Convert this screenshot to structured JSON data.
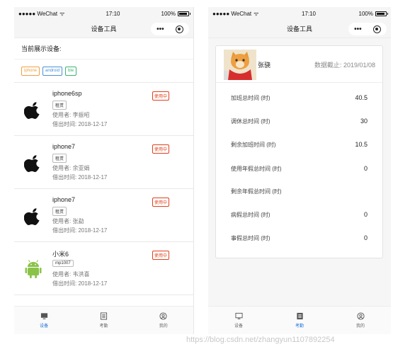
{
  "status_bar": {
    "carrier": "●●●●● WeChat",
    "wifi": "ᯤ",
    "time": "17:10",
    "battery": "100%"
  },
  "left_page": {
    "title": "设备工具",
    "section_title": "当前展示设备:",
    "filters": [
      {
        "label": "iphone",
        "color": "#f0a040"
      },
      {
        "label": "android",
        "color": "#4a90d9"
      },
      {
        "label": "ble",
        "color": "#3cb371"
      }
    ],
    "devices": [
      {
        "name": "iphone6sp",
        "tag": "租赁",
        "user": "使用者: 李振昭",
        "date": "借出时间: 2018-12-17",
        "status": "使用中",
        "logo": "apple-icon"
      },
      {
        "name": "iphone7",
        "tag": "租赁",
        "user": "使用者: 余亚娟",
        "date": "借出时间: 2018-12-17",
        "status": "使用中",
        "logo": "apple-icon"
      },
      {
        "name": "iphone7",
        "tag": "租赁",
        "user": "使用者: 张勐",
        "date": "借出时间: 2018-12-17",
        "status": "使用中",
        "logo": "apple-icon"
      },
      {
        "name": "小米6",
        "tag": "mp1007",
        "user": "使用者: 韦洪喜",
        "date": "借出时间: 2018-12-17",
        "status": "使用中",
        "logo": "android-icon"
      }
    ],
    "tabs": [
      {
        "label": "设备",
        "icon": "monitor-icon",
        "active": true
      },
      {
        "label": "考勤",
        "icon": "list-icon",
        "active": false
      },
      {
        "label": "我的",
        "icon": "user-icon",
        "active": false
      }
    ]
  },
  "right_page": {
    "title": "设备工具",
    "profile": {
      "name": "张骁",
      "date": "数据截止: 2019/01/08"
    },
    "stats": [
      {
        "label": "加班总时间 (时)",
        "value": "40.5"
      },
      {
        "label": "调休总时间 (时)",
        "value": "30"
      },
      {
        "label": "剩余加班时间 (时)",
        "value": "10.5"
      },
      {
        "label": "使用年假总时间 (时)",
        "value": "0"
      },
      {
        "label": "剩余年假总时间 (时)",
        "value": ""
      },
      {
        "label": "病假总时间 (时)",
        "value": "0"
      },
      {
        "label": "事假总时间 (时)",
        "value": "0"
      }
    ],
    "tabs": [
      {
        "label": "设备",
        "icon": "monitor-icon",
        "active": false
      },
      {
        "label": "考勤",
        "icon": "list-icon",
        "active": true
      },
      {
        "label": "我的",
        "icon": "user-icon",
        "active": false
      }
    ]
  },
  "watermark": "https://blog.csdn.net/zhangyun1107892254",
  "colors": {
    "accent": "#1a73d9",
    "in_use": "#e1401c"
  }
}
